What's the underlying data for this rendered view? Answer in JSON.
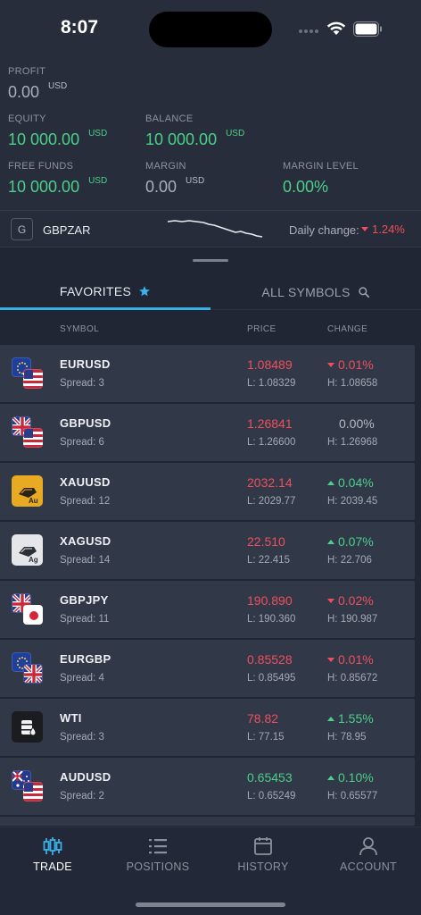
{
  "status": {
    "time": "8:07"
  },
  "account": {
    "profit_label": "PROFIT",
    "profit_value": "0.00",
    "profit_ccy": "USD",
    "equity_label": "EQUITY",
    "equity_value": "10 000.00",
    "equity_ccy": "USD",
    "balance_label": "BALANCE",
    "balance_value": "10 000.00",
    "balance_ccy": "USD",
    "free_funds_label": "FREE FUNDS",
    "free_funds_value": "10 000.00",
    "free_funds_ccy": "USD",
    "margin_label": "MARGIN",
    "margin_value": "0.00",
    "margin_ccy": "USD",
    "margin_level_label": "MARGIN LEVEL",
    "margin_level_value": "0.00%"
  },
  "ticker": {
    "badge": "G",
    "symbol": "GBPZAR",
    "daily_label": "Daily change:",
    "daily_value": "1.24%",
    "direction": "down"
  },
  "tabs": {
    "favorites": "FAVORITES",
    "all_symbols": "ALL SYMBOLS"
  },
  "table": {
    "col_symbol": "SYMBOL",
    "col_price": "PRICE",
    "col_change": "CHANGE",
    "rows": [
      {
        "symbol": "EURUSD",
        "spread": "Spread: 3",
        "price": "1.08489",
        "price_color": "red",
        "low": "L: 1.08329",
        "change": "0.01%",
        "dir": "down",
        "high": "H: 1.08658",
        "icon": "eu-us-flags-icon"
      },
      {
        "symbol": "GBPUSD",
        "spread": "Spread: 6",
        "price": "1.26841",
        "price_color": "red",
        "low": "L: 1.26600",
        "change": "0.00%",
        "dir": "none",
        "high": "H: 1.26968",
        "icon": "gb-us-flags-icon"
      },
      {
        "symbol": "XAUUSD",
        "spread": "Spread: 12",
        "price": "2032.14",
        "price_color": "red",
        "low": "L: 2029.77",
        "change": "0.04%",
        "dir": "up",
        "high": "H: 2039.45",
        "icon": "gold-bar-icon",
        "icon_text": "Au"
      },
      {
        "symbol": "XAGUSD",
        "spread": "Spread: 14",
        "price": "22.510",
        "price_color": "red",
        "low": "L: 22.415",
        "change": "0.07%",
        "dir": "up",
        "high": "H: 22.706",
        "icon": "silver-bar-icon",
        "icon_text": "Ag"
      },
      {
        "symbol": "GBPJPY",
        "spread": "Spread: 11",
        "price": "190.890",
        "price_color": "red",
        "low": "L: 190.360",
        "change": "0.02%",
        "dir": "down",
        "high": "H: 190.987",
        "icon": "gb-jp-flags-icon"
      },
      {
        "symbol": "EURGBP",
        "spread": "Spread: 4",
        "price": "0.85528",
        "price_color": "red",
        "low": "L: 0.85495",
        "change": "0.01%",
        "dir": "down",
        "high": "H: 0.85672",
        "icon": "eu-gb-flags-icon"
      },
      {
        "symbol": "WTI",
        "spread": "Spread: 3",
        "price": "78.82",
        "price_color": "red",
        "low": "L: 77.15",
        "change": "1.55%",
        "dir": "up",
        "high": "H: 78.95",
        "icon": "oil-barrel-icon"
      },
      {
        "symbol": "AUDUSD",
        "spread": "Spread: 2",
        "price": "0.65453",
        "price_color": "green",
        "low": "L: 0.65249",
        "change": "0.10%",
        "dir": "up",
        "high": "H: 0.65577",
        "icon": "au-us-flags-icon"
      }
    ]
  },
  "nav": {
    "trade": "TRADE",
    "positions": "POSITIONS",
    "history": "HISTORY",
    "account": "ACCOUNT"
  },
  "colors": {
    "accent": "#3ab1e6",
    "up": "#4cd08a",
    "down": "#ef4f5d"
  }
}
